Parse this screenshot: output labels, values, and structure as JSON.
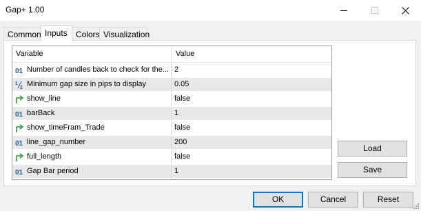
{
  "window": {
    "title": "Gap+ 1.00"
  },
  "tabs": [
    {
      "label": "Common"
    },
    {
      "label": "Inputs"
    },
    {
      "label": "Colors"
    },
    {
      "label": "Visualization"
    }
  ],
  "grid": {
    "headers": {
      "variable": "Variable",
      "value": "Value"
    },
    "rows": [
      {
        "icon": "int-icon",
        "variable": "Number of candles back to check for the...",
        "value": "2"
      },
      {
        "icon": "double-icon",
        "variable": "Minimum gap size in pips to display",
        "value": "0.05"
      },
      {
        "icon": "bool-icon",
        "variable": "show_line",
        "value": "false"
      },
      {
        "icon": "int-icon",
        "variable": "barBack",
        "value": "1"
      },
      {
        "icon": "bool-icon",
        "variable": "show_timeFram_Trade",
        "value": "false"
      },
      {
        "icon": "int-icon",
        "variable": "line_gap_number",
        "value": "200"
      },
      {
        "icon": "bool-icon",
        "variable": "full_length",
        "value": "false"
      },
      {
        "icon": "int-icon",
        "variable": "Gap Bar period",
        "value": "1"
      }
    ]
  },
  "side_buttons": {
    "load": "Load",
    "save": "Save"
  },
  "footer": {
    "ok": "OK",
    "cancel": "Cancel",
    "reset": "Reset"
  }
}
